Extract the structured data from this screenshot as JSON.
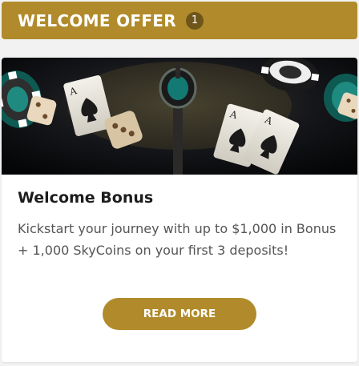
{
  "header": {
    "title": "WELCOME OFFER",
    "count": "1"
  },
  "card": {
    "image_icon": "casino-chips-cards-dice",
    "title": "Welcome Bonus",
    "description": "Kickstart your journey with up to $1,000 in Bonus + 1,000 SkyCoins on your first 3 deposits!",
    "button_label": "READ MORE"
  },
  "colors": {
    "accent": "#b18b2b",
    "badge": "#6e561a",
    "background": "#f2f2f2"
  }
}
